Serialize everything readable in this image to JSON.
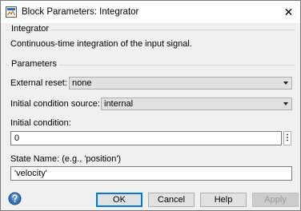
{
  "window": {
    "title": "Block Parameters: Integrator",
    "close_glyph": "✕"
  },
  "integrator": {
    "group_title": "Integrator",
    "description": "Continuous-time integration of the input signal."
  },
  "parameters": {
    "group_title": "Parameters",
    "external_reset_label": "External reset:",
    "external_reset_value": "none",
    "ic_source_label": "Initial condition source:",
    "ic_source_value": "internal",
    "initial_condition_label": "Initial condition:",
    "initial_condition_value": "0",
    "more_glyph": "⋮",
    "state_name_label": "State Name: (e.g., 'position')",
    "state_name_value": "'velocity'"
  },
  "buttons": {
    "ok": "OK",
    "cancel": "Cancel",
    "help": "Help",
    "apply": "Apply"
  },
  "icons": {
    "app": "simulink-block-icon",
    "help": "help-question-icon"
  },
  "colors": {
    "accent": "#0078d7",
    "help_icon": "#2e6fb7"
  }
}
